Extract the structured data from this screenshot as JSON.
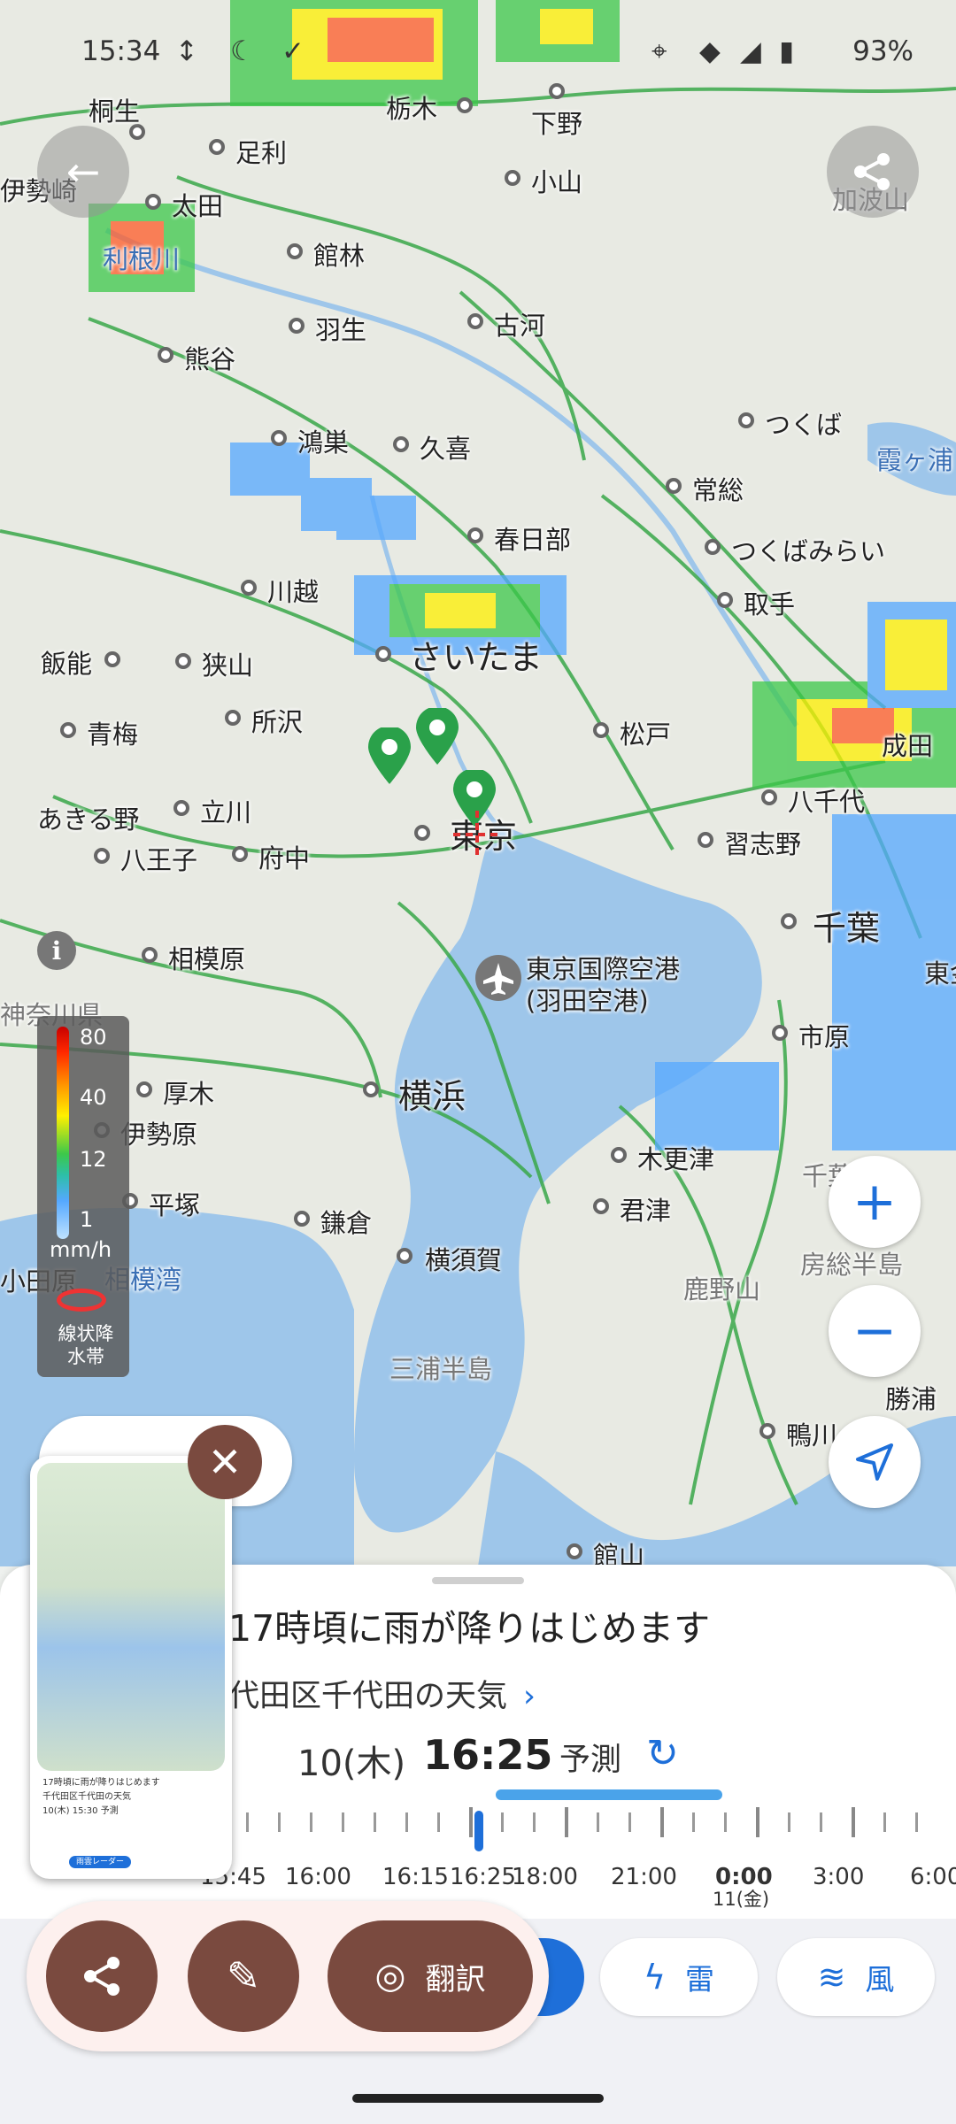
{
  "status_bar": {
    "time": "15:34",
    "battery": "93%"
  },
  "map": {
    "labels": [
      {
        "text": "桐生",
        "size": "n"
      },
      {
        "text": "栃木",
        "size": "n"
      },
      {
        "text": "下野",
        "size": "n"
      },
      {
        "text": "足利",
        "size": "n"
      },
      {
        "text": "伊勢崎",
        "size": "n"
      },
      {
        "text": "小山",
        "size": "n"
      },
      {
        "text": "加波山",
        "size": "g"
      },
      {
        "text": "太田",
        "size": "n"
      },
      {
        "text": "利根川",
        "size": "w"
      },
      {
        "text": "館林",
        "size": "n"
      },
      {
        "text": "羽生",
        "size": "n"
      },
      {
        "text": "古河",
        "size": "n"
      },
      {
        "text": "熊谷",
        "size": "n"
      },
      {
        "text": "鴻巣",
        "size": "n"
      },
      {
        "text": "久喜",
        "size": "n"
      },
      {
        "text": "つくば",
        "size": "n"
      },
      {
        "text": "霞ヶ浦",
        "size": "w"
      },
      {
        "text": "常総",
        "size": "n"
      },
      {
        "text": "春日部",
        "size": "n"
      },
      {
        "text": "つくばみらい",
        "size": "n"
      },
      {
        "text": "川越",
        "size": "n"
      },
      {
        "text": "取手",
        "size": "n"
      },
      {
        "text": "飯能",
        "size": "n"
      },
      {
        "text": "狭山",
        "size": "n"
      },
      {
        "text": "さいたま",
        "size": "b"
      },
      {
        "text": "所沢",
        "size": "n"
      },
      {
        "text": "松戸",
        "size": "n"
      },
      {
        "text": "成田",
        "size": "n"
      },
      {
        "text": "青梅",
        "size": "n"
      },
      {
        "text": "八千代",
        "size": "n"
      },
      {
        "text": "あきる野",
        "size": "n"
      },
      {
        "text": "立川",
        "size": "n"
      },
      {
        "text": "習志野",
        "size": "n"
      },
      {
        "text": "八王子",
        "size": "n"
      },
      {
        "text": "府中",
        "size": "n"
      },
      {
        "text": "東京",
        "size": "b"
      },
      {
        "text": "千葉",
        "size": "b"
      },
      {
        "text": "相模原",
        "size": "n"
      },
      {
        "text": "東京国際空港",
        "size": "n"
      },
      {
        "text": "(羽田空港)",
        "size": "n"
      },
      {
        "text": "神奈川県",
        "size": "g"
      },
      {
        "text": "市原",
        "size": "n"
      },
      {
        "text": "東金",
        "size": "n"
      },
      {
        "text": "厚木",
        "size": "n"
      },
      {
        "text": "横浜",
        "size": "b"
      },
      {
        "text": "伊勢原",
        "size": "n"
      },
      {
        "text": "木更津",
        "size": "n"
      },
      {
        "text": "平塚",
        "size": "n"
      },
      {
        "text": "君津",
        "size": "n"
      },
      {
        "text": "鎌倉",
        "size": "n"
      },
      {
        "text": "房総半島",
        "size": "g"
      },
      {
        "text": "横須賀",
        "size": "n"
      },
      {
        "text": "相模湾",
        "size": "w"
      },
      {
        "text": "小田原",
        "size": "n"
      },
      {
        "text": "鹿野山",
        "size": "g"
      },
      {
        "text": "三浦半島",
        "size": "g"
      },
      {
        "text": "勝浦",
        "size": "n"
      },
      {
        "text": "鴨川",
        "size": "n"
      },
      {
        "text": "館山",
        "size": "n"
      },
      {
        "text": "千葉県",
        "size": "g"
      }
    ],
    "zoom_in": "+",
    "zoom_out": "−"
  },
  "legend": {
    "levels": [
      "80",
      "40",
      "12",
      "1"
    ],
    "unit": "mm/h",
    "caption": "線状降水帯"
  },
  "sheet": {
    "headline": "17時頃に雨が降りはじめます",
    "place": "代田区千代田の天気",
    "date": "10(木)",
    "time": "16:25",
    "mode": "予測",
    "timeline": {
      "labels": [
        "15:45",
        "16:00",
        "16:15",
        "16:25",
        "18:00",
        "21:00",
        "0:00",
        "3:00",
        "6:00"
      ],
      "sub_label": "11(金)"
    }
  },
  "bottom_chips": {
    "thunder": "雷",
    "wind": "風"
  },
  "overlay": {
    "translate_label": "翻訳",
    "thumb_text": "17時頃に雨が降りはじめます",
    "thumb_sub": "千代田区千代田の天気",
    "thumb_time": "10(木) 15:30 予測",
    "thumb_tab": "雨雲レーダー"
  }
}
